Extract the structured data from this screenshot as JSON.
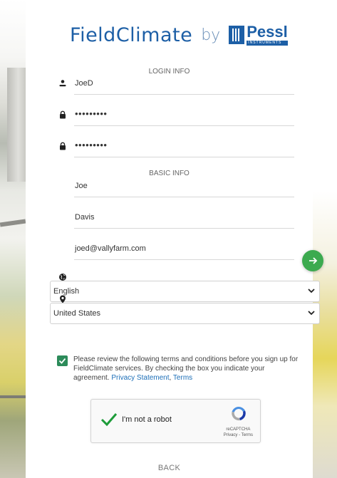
{
  "brand": {
    "product": "FieldClimate",
    "by": "by",
    "company": "Pessl",
    "company_sub": "INSTRUMENTS"
  },
  "login_info": {
    "title": "LOGIN INFO",
    "username": "JoeD",
    "password": "•••••••••",
    "password_confirm": "•••••••••"
  },
  "basic_info": {
    "title": "BASIC INFO",
    "first_name": "Joe",
    "last_name": "Davis",
    "email": "joed@vallyfarm.com"
  },
  "language": {
    "selected": "English"
  },
  "country": {
    "selected": "United States"
  },
  "terms": {
    "checked": true,
    "text": "Please review the following terms and conditions before you sign up for FieldClimate services. By checking the box you indicate your agreement.",
    "privacy_link": "Privacy Statement",
    "separator": ",",
    "terms_link": "Terms"
  },
  "recaptcha": {
    "label": "I'm not a robot",
    "brand": "reCAPTCHA",
    "links": "Privacy - Terms"
  },
  "back_label": "BACK",
  "colors": {
    "brand_blue": "#1d5fa6",
    "accent_green": "#3caa4f",
    "checkbox_green": "#2c8b5a",
    "link": "#1d6fb8"
  },
  "icons": [
    "user-icon",
    "lock-icon",
    "globe-icon",
    "map-pin-icon",
    "chevron-down-icon",
    "checkmark-icon",
    "arrow-right-icon",
    "recaptcha-icon"
  ]
}
